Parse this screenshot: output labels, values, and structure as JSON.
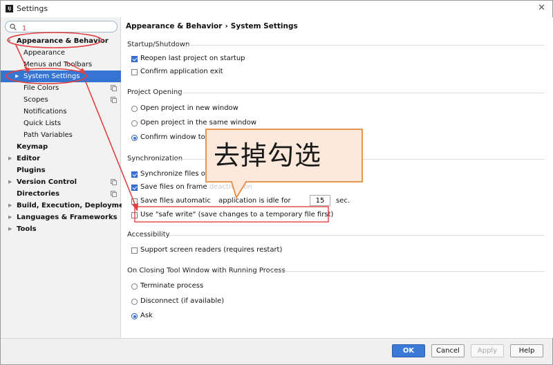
{
  "window": {
    "title": "Settings",
    "app_icon": "IJ",
    "close_glyph": "✕"
  },
  "search": {
    "value": "",
    "placeholder": ""
  },
  "tree": [
    {
      "label": "Appearance & Behavior",
      "bold": true,
      "arrow": "▾",
      "indent": 0
    },
    {
      "label": "Appearance",
      "indent": 1
    },
    {
      "label": "Menus and Toolbars",
      "indent": 1
    },
    {
      "label": "System Settings",
      "indent": 1,
      "arrow": "▶",
      "selected": true
    },
    {
      "label": "File Colors",
      "indent": 1,
      "copy": true
    },
    {
      "label": "Scopes",
      "indent": 1,
      "copy": true
    },
    {
      "label": "Notifications",
      "indent": 1
    },
    {
      "label": "Quick Lists",
      "indent": 1
    },
    {
      "label": "Path Variables",
      "indent": 1
    },
    {
      "label": "Keymap",
      "bold": true,
      "indent": 0
    },
    {
      "label": "Editor",
      "bold": true,
      "arrow": "▶",
      "indent": 0
    },
    {
      "label": "Plugins",
      "bold": true,
      "indent": 0
    },
    {
      "label": "Version Control",
      "bold": true,
      "arrow": "▶",
      "indent": 0,
      "copy": true
    },
    {
      "label": "Directories",
      "bold": true,
      "indent": 0,
      "copy": true
    },
    {
      "label": "Build, Execution, Deployment",
      "bold": true,
      "arrow": "▶",
      "indent": 0
    },
    {
      "label": "Languages & Frameworks",
      "bold": true,
      "arrow": "▶",
      "indent": 0
    },
    {
      "label": "Tools",
      "bold": true,
      "arrow": "▶",
      "indent": 0
    }
  ],
  "breadcrumb": {
    "parent": "Appearance & Behavior",
    "separator": "›",
    "current": "System Settings"
  },
  "startup": {
    "title": "Startup/Shutdown",
    "reopen_label": "Reopen last project on startup",
    "reopen_checked": true,
    "confirm_exit_label": "Confirm application exit",
    "confirm_exit_checked": false
  },
  "project_opening": {
    "title": "Project Opening",
    "new_window_label": "Open project in new window",
    "same_window_label": "Open project in the same window",
    "confirm_label": "Confirm window to",
    "confirm_label_faded": "open project in",
    "selected": "confirm"
  },
  "sync": {
    "title": "Synchronization",
    "sync_files_label": "Synchronize files o",
    "sync_files_faded": "activation",
    "sync_checked": true,
    "save_frame_label": "Save files on frame",
    "save_frame_faded": "deactivation",
    "save_frame_checked": true,
    "save_auto_label": "Save files automatic",
    "save_auto_label_rest": "application is idle for",
    "save_auto_checked": false,
    "idle_seconds": "15",
    "sec_label": "sec.",
    "safe_write_label": "Use \"safe write\" (save changes to a temporary file first)",
    "safe_write_checked": false
  },
  "accessibility": {
    "title": "Accessibility",
    "screen_readers_label": "Support screen readers (requires restart)",
    "screen_readers_checked": false
  },
  "closing": {
    "title": "On Closing Tool Window with Running Process",
    "terminate_label": "Terminate process",
    "disconnect_label": "Disconnect (if available)",
    "ask_label": "Ask",
    "selected": "ask"
  },
  "footer": {
    "ok_label": "OK",
    "cancel_label": "Cancel",
    "apply_label": "Apply",
    "help_label": "Help"
  },
  "annotation": {
    "callout": "去掉勾选",
    "number": "1",
    "color": "#e34141",
    "callout_border": "#e8964f",
    "callout_fill": "#fde7d9"
  },
  "icons": {
    "search": "magnifier-icon",
    "copy": "copy-settings-icon",
    "close": "close-icon"
  }
}
